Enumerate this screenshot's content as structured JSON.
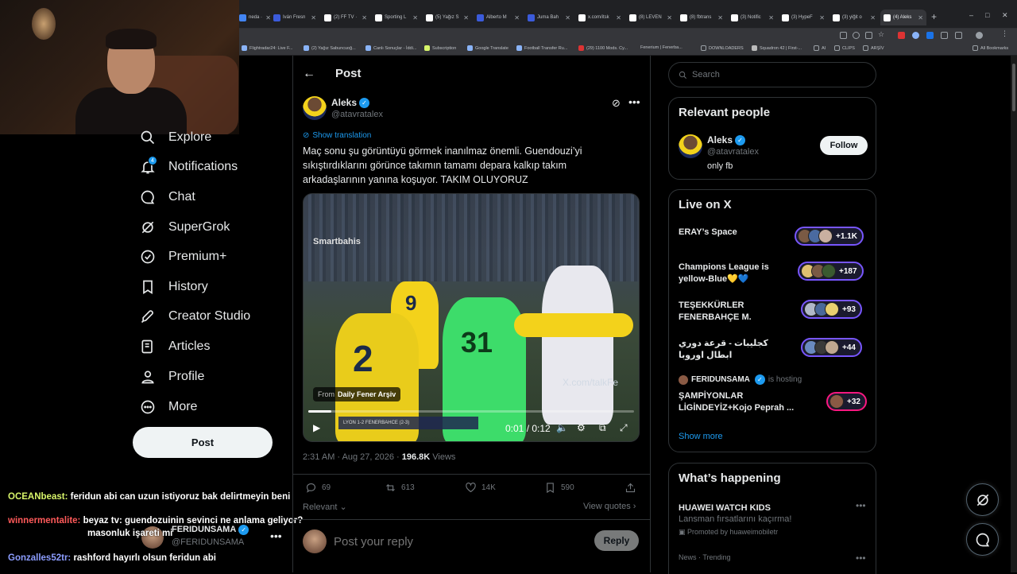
{
  "browser": {
    "tabs": [
      {
        "label": "neda ·"
      },
      {
        "label": "Iván Fresn"
      },
      {
        "label": "(2) FF TV ·"
      },
      {
        "label": "Sporting L"
      },
      {
        "label": "(5) Yağız S"
      },
      {
        "label": "Alberto M"
      },
      {
        "label": "Juma Bah"
      },
      {
        "label": "x.com/itsk"
      },
      {
        "label": "(8) LEVEN"
      },
      {
        "label": "(8) fbtrans"
      },
      {
        "label": "(3) Notific"
      },
      {
        "label": "(3) HypeF"
      },
      {
        "label": "(3) yiğit o"
      },
      {
        "label": "(4) Aleks"
      }
    ],
    "new_tab": "+",
    "bookmarks": [
      {
        "label": "Flightradar24: Live F..."
      },
      {
        "label": "(2) Yağız Sabuncuoğ..."
      },
      {
        "label": "Canlı Sonuçlar - İddi..."
      },
      {
        "label": "Subscription"
      },
      {
        "label": "Google Translate"
      },
      {
        "label": "Football Transfer Ru..."
      },
      {
        "label": "(29) 1100 Mods. Cy..."
      },
      {
        "label": "Fenerium | Fenerba..."
      },
      {
        "label": "DOWNLOADERS"
      },
      {
        "label": "Squadron 42 | First-..."
      },
      {
        "label": "AI"
      },
      {
        "label": "CLIPS"
      },
      {
        "label": "ARŞİV"
      },
      {
        "label": "All Bookmarks"
      }
    ]
  },
  "nav": {
    "items": [
      {
        "label": "Explore",
        "icon": "search-icon"
      },
      {
        "label": "Notifications",
        "icon": "bell-icon"
      },
      {
        "label": "Chat",
        "icon": "chat-icon"
      },
      {
        "label": "SuperGrok",
        "icon": "grok-icon"
      },
      {
        "label": "Premium+",
        "icon": "premium-icon"
      },
      {
        "label": "History",
        "icon": "bookmark-icon"
      },
      {
        "label": "Creator Studio",
        "icon": "rocket-icon"
      },
      {
        "label": "Articles",
        "icon": "articles-icon"
      },
      {
        "label": "Profile",
        "icon": "person-icon"
      },
      {
        "label": "More",
        "icon": "more-circle-icon"
      }
    ],
    "notification_count": "4",
    "post_button": "Post"
  },
  "chat_overlay": {
    "messages": [
      {
        "user": "OCEANbeast:",
        "text": "feridun abi can uzun istiyoruz bak delirtmeyin beni"
      },
      {
        "user": "winnermentalite:",
        "text": "beyaz tv: guendozuinin sevinci ne anlama geliyor?",
        "text2": "masonluk işareti mi"
      },
      {
        "user": "Gonzalles52tr:",
        "text": "rashford hayırlı olsun feridun abi"
      }
    ]
  },
  "account": {
    "name": "FERIDUNSAMA",
    "handle": "@FERIDUNSAMA"
  },
  "post": {
    "header": "Post",
    "author_name": "Aleks",
    "author_handle": "@atavratalex",
    "show_translation": "Show translation",
    "text": "Maç sonu şu görüntüyü görmek inanılmaz önemli. Guendouzi’yi sıkıştırdıklarını görünce takımın tamamı depara kalkıp takım arkadaşlarının yanına koşuyor. TAKIM OLUYORUZ",
    "video": {
      "watermark": "Smartbahis",
      "from_label": "From",
      "from_source": "Daily Fener Arşiv",
      "site_watermark": "X.com/talkFe",
      "scoreboard": "LYON 1-2 FENERBAHCE (2-3)",
      "time": "0:01 / 0:12",
      "progress": 0.07,
      "jersey_numbers": [
        "2",
        "9",
        "31"
      ]
    },
    "timestamp": "2:31 AM · Aug 27, 2026 · ",
    "views_count": "196.8K",
    "views_label": " Views",
    "stats": {
      "replies": "69",
      "reposts": "613",
      "likes": "14K",
      "bookmarks": "590"
    },
    "relevant": "Relevant",
    "view_quotes": "View quotes",
    "reply_placeholder": "Post your reply",
    "reply_button": "Reply"
  },
  "sidebar": {
    "search_placeholder": "Search",
    "relevant_people": {
      "title": "Relevant people",
      "name": "Aleks",
      "handle": "@atavratalex",
      "bio": "only fb",
      "follow": "Follow"
    },
    "live": {
      "title": "Live on X",
      "spaces": [
        {
          "title": "ERAY’s Space",
          "count": "+1.1K"
        },
        {
          "title": "Champions League is yellow-Blue💛💙",
          "count": "+187"
        },
        {
          "title": "TEŞEKKÜRLER FENERBAHÇE M.",
          "count": "+93"
        },
        {
          "title": "كجليبات - قرعة دوري ابطال اوروبا",
          "count": "+44"
        },
        {
          "title": "ŞAMPİYONLAR LİGİNDEYİZ+Kojo Peprah ...",
          "count": "+32"
        }
      ],
      "host_name": "FERIDUNSAMA",
      "host_suffix": "is hosting",
      "show_more": "Show more"
    },
    "whats_happening": {
      "title": "What’s happening",
      "item_title": "HUAWEI WATCH KIDS",
      "item_sub": "Lansman fırsatlarını kaçırma!",
      "item_promo": "Promoted by huaweimobiletr",
      "next_meta": "News · Trending"
    }
  },
  "colors": {
    "accent": "#1d9bf0",
    "live_border": "#7856ff",
    "host_border": "#f91880",
    "fb_yellow": "#f3d21b",
    "keeper_green": "#3ddc6a"
  }
}
